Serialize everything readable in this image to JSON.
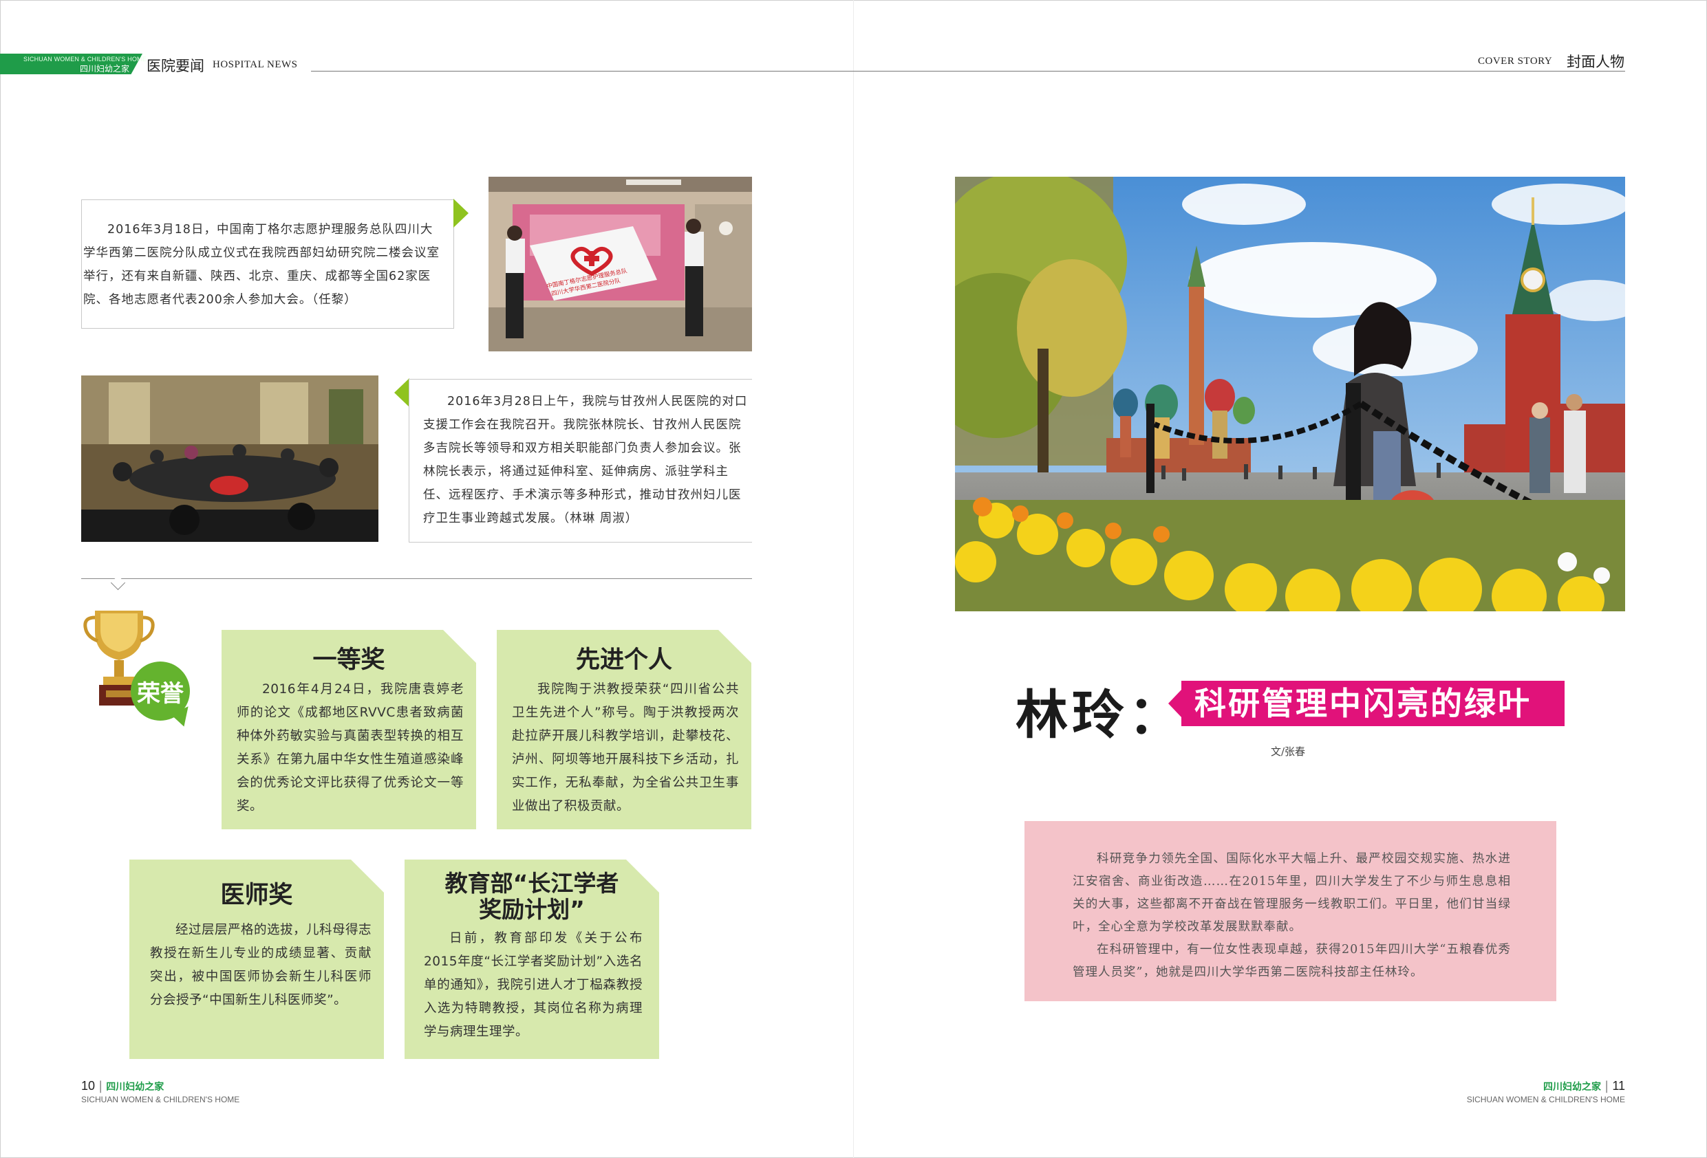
{
  "header": {
    "tab_en": "SICHUAN WOMEN & CHILDREN'S HOME",
    "tab_zh": "四川妇幼之家",
    "left_zh": "医院要闻",
    "left_en": "HOSPITAL NEWS",
    "right_en": "COVER STORY",
    "right_zh": "封面人物"
  },
  "news": [
    {
      "text": "2016年3月18日，中国南丁格尔志愿护理服务总队四川大学华西第二医院分队成立仪式在我院西部妇幼研究院二楼会议室举行，还有来自新疆、陕西、北京、重庆、成都等全国62家医院、各地志愿者代表200余人参加大会。（任黎）",
      "photo": "flag-presentation-photo"
    },
    {
      "text": "2016年3月28日上午，我院与甘孜州人民医院的对口支援工作会在我院召开。我院张林院长、甘孜州人民医院多吉院长等领导和双方相关职能部门负责人参加会议。张林院长表示，将通过延伸科室、延伸病房、派驻学科主任、远程医疗、手术演示等多种形式，推动甘孜州妇儿医疗卫生事业跨越式发展。（林琳 周淑）",
      "photo": "meeting-photo"
    }
  ],
  "flag": {
    "line1": "中国南丁格尔志愿护理服务总队",
    "line2": "四川大学华西第二医院分队"
  },
  "honor": {
    "badge": "荣誉",
    "cards": [
      {
        "title": "一等奖",
        "text": "2016年4月24日，我院唐袁婷老师的论文《成都地区RVVC患者致病菌种体外药敏实验与真菌表型转换的相互关系》在第九届中华女性生殖道感染峰会的优秀论文评比获得了优秀论文一等奖。"
      },
      {
        "title": "先进个人",
        "text": "我院陶于洪教授荣获“四川省公共卫生先进个人”称号。陶于洪教授两次赴拉萨开展儿科教学培训，赴攀枝花、泸州、阿坝等地开展科技下乡活动，扎实工作，无私奉献，为全省公共卫生事业做出了积极贡献。"
      },
      {
        "title": "医师奖",
        "text": "经过层层严格的选拔，儿科母得志教授在新生儿专业的成绩显著、贡献突出，被中国医师协会新生儿科医师分会授予“中国新生儿科医师奖”。"
      },
      {
        "title_line1": "教育部“长江学者",
        "title_line2": "奖励计划”",
        "text": "日前，教育部印发《关于公布2015年度“长江学者奖励计划”入选名单的通知》，我院引进人才丁榀森教授入选为特聘教授，其岗位名称为病理学与病理生理学。"
      }
    ]
  },
  "footer": {
    "left_num": "10",
    "left_zh": "四川妇幼之家",
    "left_en": "SICHUAN WOMEN & CHILDREN'S HOME",
    "right_zh": "四川妇幼之家",
    "right_num": "11",
    "right_en": "SICHUAN WOMEN & CHILDREN'S HOME",
    "sep": "|"
  },
  "cover": {
    "name": "林玲：",
    "subtitle": "科研管理中闪亮的绿叶",
    "byline": "文/张春",
    "intro_p1": "科研竞争力领先全国、国际化水平大幅上升、最严校园交规实施、热水进江安宿舍、商业街改造……在2015年里，四川大学发生了不少与师生息息相关的大事，这些都离不开奋战在管理服务一线教职工们。平日里，他们甘当绿叶，全心全意为学校改革发展默默奉献。",
    "intro_p2": "在科研管理中，有一位女性表现卓越，获得2015年四川大学“五粮春优秀管理人员奖”，她就是四川大学华西第二医院科技部主任林玲。"
  },
  "colors": {
    "brand_green": "#1f9c49",
    "arrow_green": "#8fc31f",
    "card_green": "#d7e9ad",
    "honor_green": "#64b32e",
    "title_magenta": "#e1127a",
    "intro_pink": "#f4c3c9"
  }
}
